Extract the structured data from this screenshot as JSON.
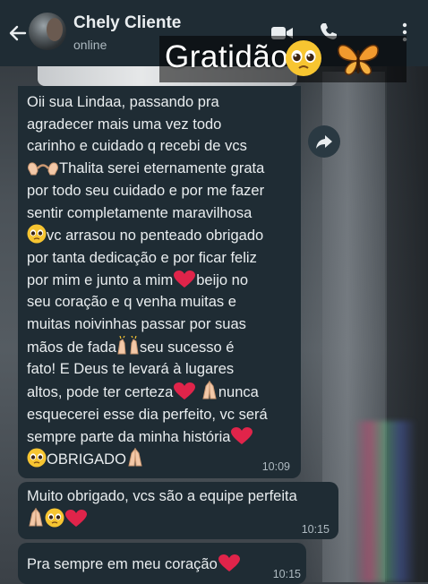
{
  "header": {
    "contact_name": "Chely Cliente",
    "status": "online"
  },
  "sticker": {
    "text": "Gratidão"
  },
  "messages": [
    {
      "lines": [
        "Oii sua Lindaa, passando pra",
        "agradecer mais uma vez todo",
        "carinho e cuidado q recebi de vcs",
        "Thalita serei eternamente grata",
        "por todo seu cuidado e por me fazer",
        "sentir completamente maravilhosa",
        "vc arrasou no penteado obrigado",
        "por tanta dedicação e por ficar feliz",
        "por mim e junto a mim",
        "beijo no",
        "seu coração e q venha muitas e",
        "muitas noivinhas passar por suas",
        "mãos de fada",
        "seu sucesso é",
        "fato! E Deus te levará à lugares",
        "altos, pode ter certeza",
        "nunca",
        "esquecerei esse dia perfeito, vc será",
        "sempre parte da minha história",
        "OBRIGADO"
      ],
      "time": "10:09"
    },
    {
      "text": "Muito obrigado, vcs são a equipe perfeita",
      "time": "10:15"
    },
    {
      "text": "Pra sempre em meu coração",
      "time": "10:15"
    }
  ],
  "colors": {
    "header_bg": "#1f2c34",
    "bubble_bg": "#1f2c34",
    "text": "#e9edef",
    "meta": "#aebac1",
    "heart": "#e0244a"
  },
  "icons": [
    "back-arrow-icon",
    "video-call-icon",
    "phone-icon",
    "menu-icon",
    "forward-icon",
    "pleading-face-icon",
    "butterfly-icon",
    "heart-hands-icon",
    "red-heart-icon",
    "raising-hands-icon",
    "folded-hands-icon"
  ]
}
